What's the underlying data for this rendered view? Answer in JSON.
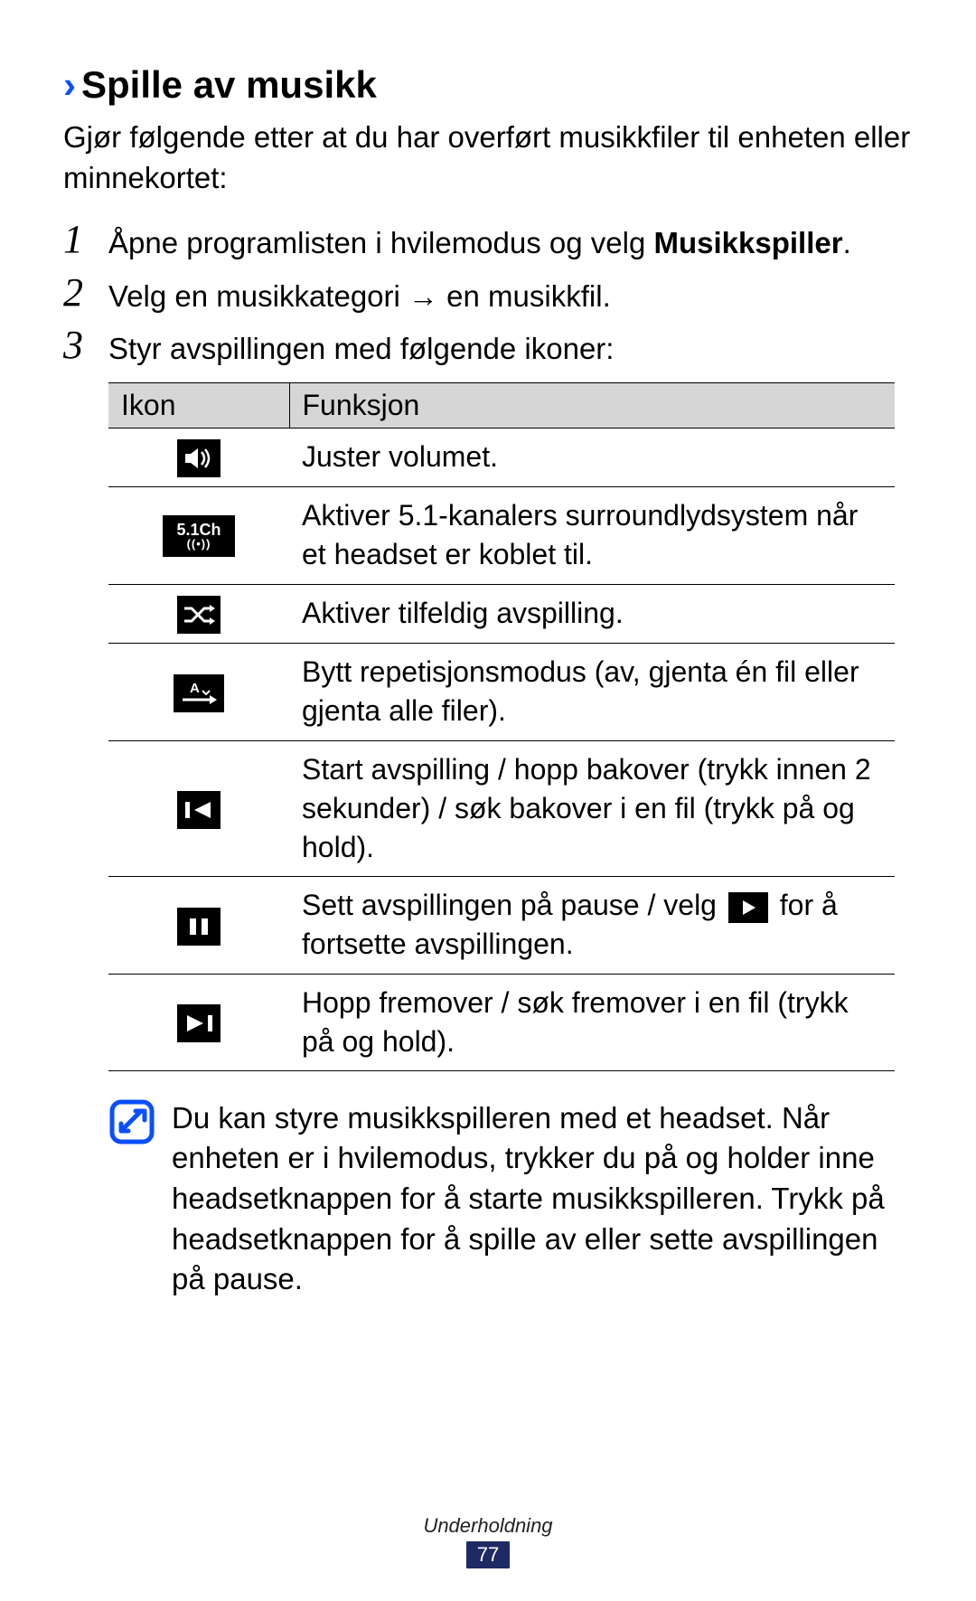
{
  "heading": "Spille av musikk",
  "intro": "Gjør følgende etter at du har overført musikkfiler til enheten eller minnekortet:",
  "steps": {
    "s1_pre": "Åpne programlisten i hvilemodus og velg ",
    "s1_bold": "Musikkspiller",
    "s1_post": ".",
    "s2_pre": "Velg en musikkategori ",
    "s2_arrow": "→",
    "s2_post": " en musikkfil.",
    "s3": "Styr avspillingen med følgende ikoner:"
  },
  "step_nums": {
    "n1": "1",
    "n2": "2",
    "n3": "3"
  },
  "table": {
    "head_icon": "Ikon",
    "head_func": "Funksjon",
    "rows": {
      "r1": "Juster volumet.",
      "r2": "Aktiver 5.1-kanalers surroundlydsystem når et headset er koblet til.",
      "r3": "Aktiver tilfeldig avspilling.",
      "r4": "Bytt repetisjonsmodus (av, gjenta én fil eller gjenta alle filer).",
      "r5": "Start avspilling / hopp bakover (trykk innen 2 sekunder) / søk bakover i en fil (trykk på og hold).",
      "r6_pre": "Sett avspillingen på pause / velg ",
      "r6_post": " for å fortsette avspillingen.",
      "r7": "Hopp fremover / søk fremover i en fil (trykk på og hold)."
    },
    "icon_labels": {
      "surround_top": "5.1Ch",
      "surround_bot": "((•))",
      "repeat_letter": "A"
    }
  },
  "note": "Du kan styre musikkspilleren med et headset. Når enheten er i hvilemodus, trykker du på og holder inne headsetknappen for å starte musikkspilleren. Trykk på headsetknappen for å spille av eller sette avspillingen på pause.",
  "footer_label": "Underholdning",
  "page_number": "77"
}
